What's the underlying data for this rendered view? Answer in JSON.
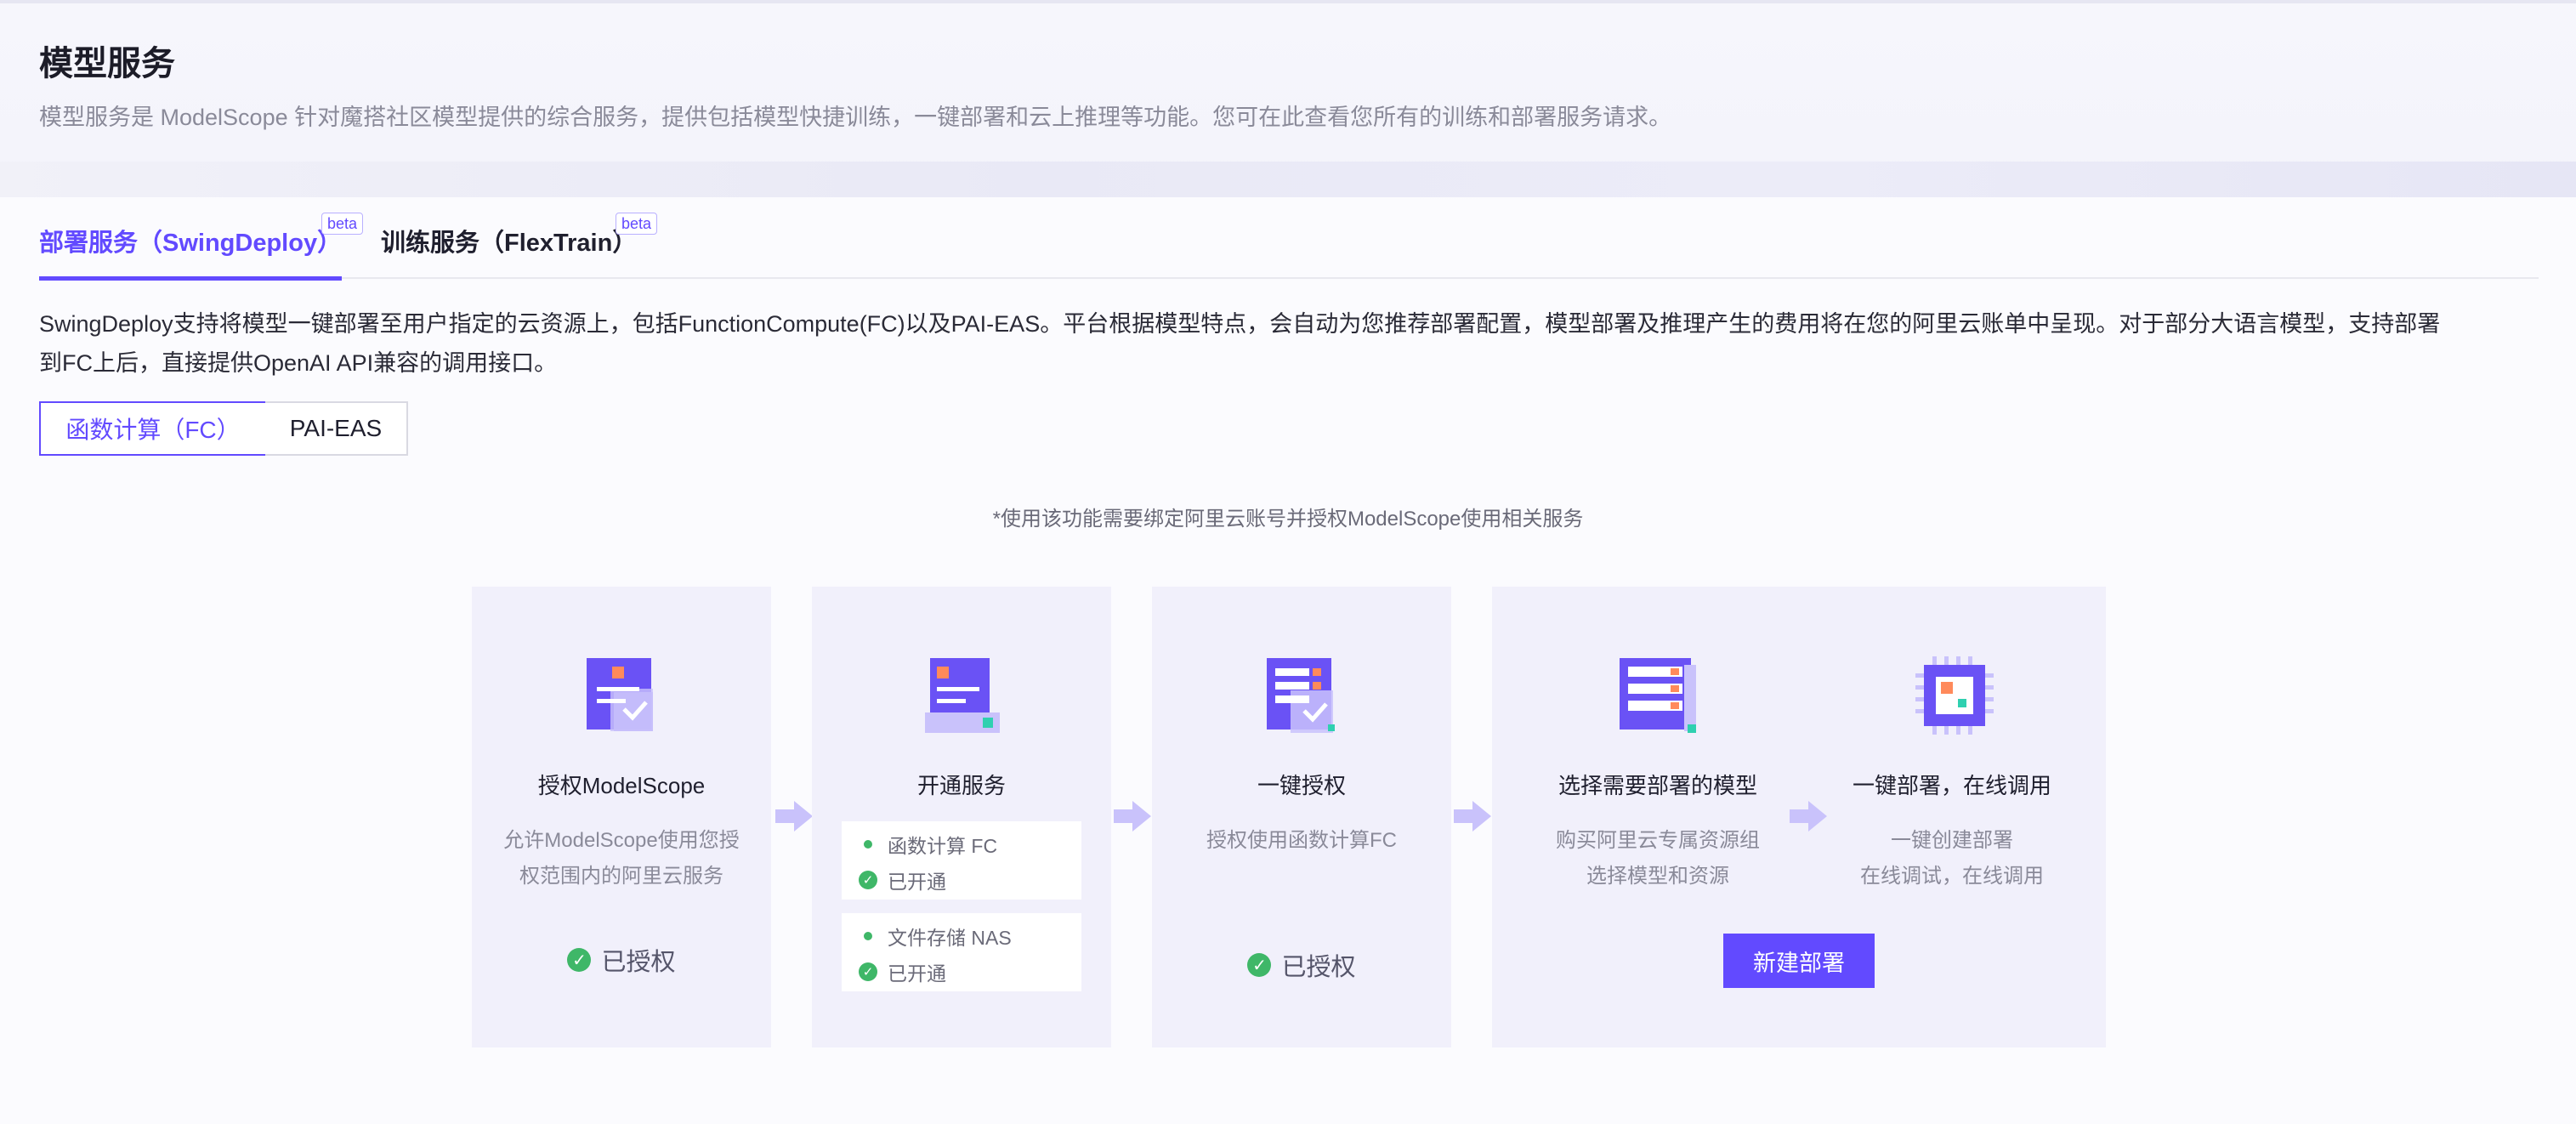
{
  "page": {
    "title": "模型服务",
    "description": "模型服务是 ModelScope 针对魔搭社区模型提供的综合服务，提供包括模型快捷训练，一键部署和云上推理等功能。您可在此查看您所有的训练和部署服务请求。"
  },
  "tabs": [
    {
      "label": "部署服务（SwingDeploy）",
      "badge": "beta",
      "active": true
    },
    {
      "label": "训练服务（FlexTrain）",
      "badge": "beta",
      "active": false
    }
  ],
  "intro_lines": [
    "SwingDeploy支持将模型一键部署至用户指定的云资源上，包括FunctionCompute(FC)以及PAI-EAS。平台根据模型特点，会自动为您推荐部署配置，模型部署及推理产生的费用将在您的阿里云账单中呈现。对于部分大语言模型，支持部署",
    "到FC上后，直接提供OpenAI API兼容的调用接口。"
  ],
  "platform_switch": {
    "options": [
      "函数计算（FC）",
      "PAI-EAS"
    ],
    "selected": "函数计算（FC）"
  },
  "note": "*使用该功能需要绑定阿里云账号并授权ModelScope使用相关服务",
  "steps": {
    "authorize": {
      "icon": "document-check-icon",
      "title": "授权ModelScope",
      "desc_lines": [
        "允许ModelScope使用您授",
        "权范围内的阿里云服务"
      ],
      "status": "已授权"
    },
    "activate": {
      "icon": "server-document-icon",
      "title": "开通服务",
      "services": [
        {
          "name": "函数计算 FC",
          "status": "已开通"
        },
        {
          "name": "文件存储 NAS",
          "status": "已开通"
        }
      ]
    },
    "one_click_auth": {
      "icon": "list-check-icon",
      "title": "一键授权",
      "desc_lines": [
        "授权使用函数计算FC"
      ],
      "status": "已授权"
    },
    "select_model": {
      "icon": "stacked-list-icon",
      "title": "选择需要部署的模型",
      "desc_lines": [
        "购买阿里云专属资源组",
        "选择模型和资源"
      ]
    },
    "deploy": {
      "icon": "chip-icon",
      "title": "一键部署，在线调用",
      "desc_lines": [
        "一键创建部署",
        "在线调试，在线调用"
      ],
      "button": "新建部署"
    }
  },
  "colors": {
    "accent": "#624aff",
    "success": "#3fb768",
    "card_bg": "#f1f0fb"
  }
}
